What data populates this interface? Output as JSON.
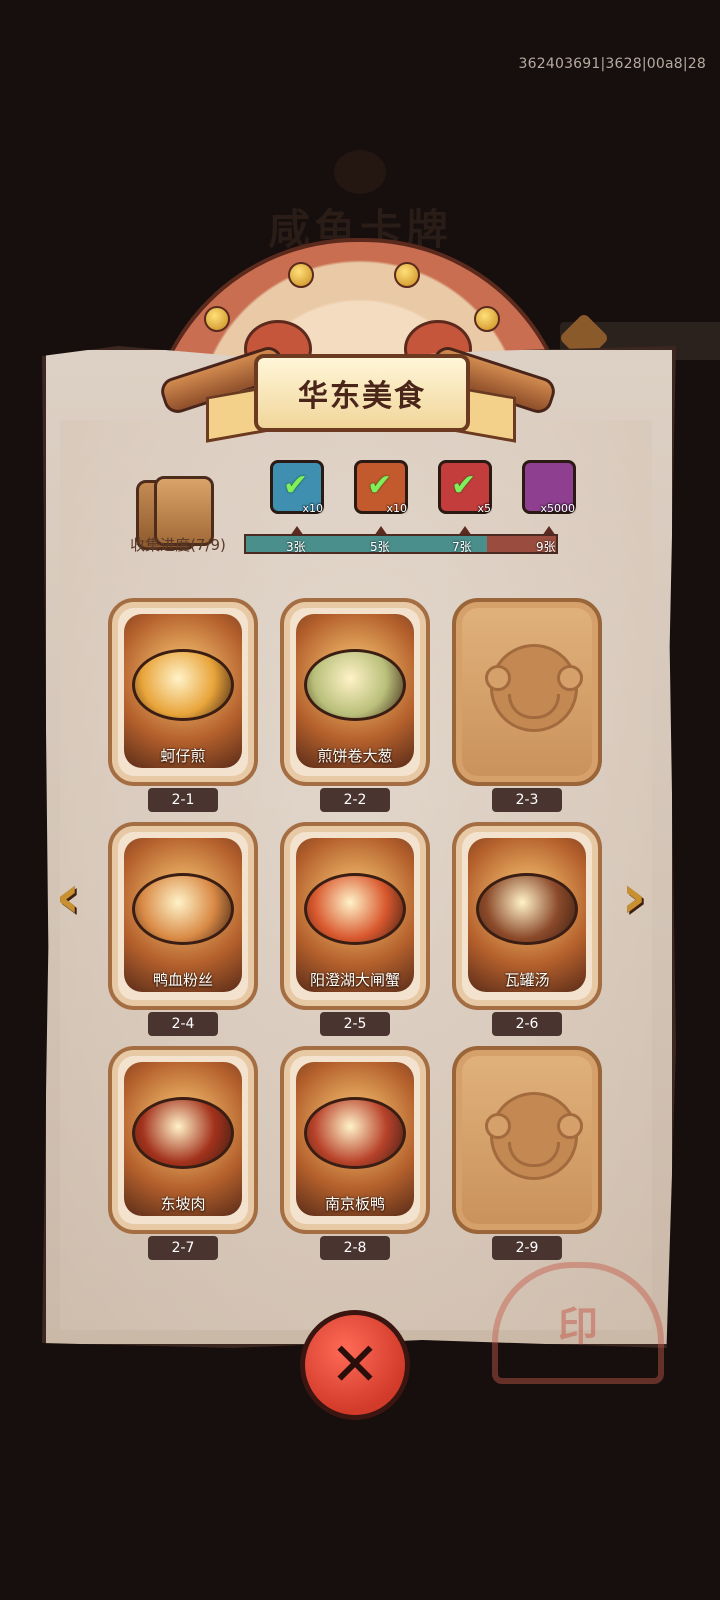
{
  "debug_id": "362403691|3628|00a8|28",
  "bg_title": "咸鱼卡牌",
  "panel": {
    "title": "华东美食",
    "collect_label": "收集进度(7/9)",
    "progress_fraction": 0.778
  },
  "rewards": [
    {
      "icon": "chest-icon",
      "qty": "x10",
      "color": "#3e8fb0",
      "claimed": true
    },
    {
      "icon": "scroll-icon",
      "qty": "x10",
      "color": "#c25a2e",
      "claimed": true
    },
    {
      "icon": "orb-icon",
      "qty": "x5",
      "color": "#c43d3d",
      "claimed": true
    },
    {
      "icon": "crystal-icon",
      "qty": "x5000",
      "color": "#8e3f8f",
      "claimed": false
    }
  ],
  "milestones": [
    "3张",
    "5张",
    "7张",
    "9张"
  ],
  "cards": [
    {
      "name": "蚵仔煎",
      "id": "2-1",
      "locked": false,
      "color": "#e8a43a"
    },
    {
      "name": "煎饼卷大葱",
      "id": "2-2",
      "locked": false,
      "color": "#b9c07a"
    },
    {
      "name": "",
      "id": "2-3",
      "locked": true,
      "color": "#c9915b"
    },
    {
      "name": "鸭血粉丝",
      "id": "2-4",
      "locked": false,
      "color": "#d98a45"
    },
    {
      "name": "阳澄湖大闸蟹",
      "id": "2-5",
      "locked": false,
      "color": "#d9582e"
    },
    {
      "name": "瓦罐汤",
      "id": "2-6",
      "locked": false,
      "color": "#8b4a2a"
    },
    {
      "name": "东坡肉",
      "id": "2-7",
      "locked": false,
      "color": "#a3321c"
    },
    {
      "name": "南京板鸭",
      "id": "2-8",
      "locked": false,
      "color": "#b8422a"
    },
    {
      "name": "",
      "id": "2-9",
      "locked": true,
      "color": "#c9915b"
    }
  ],
  "nav": {
    "prev": "‹",
    "next": "›"
  },
  "close": {
    "label": "✕"
  }
}
